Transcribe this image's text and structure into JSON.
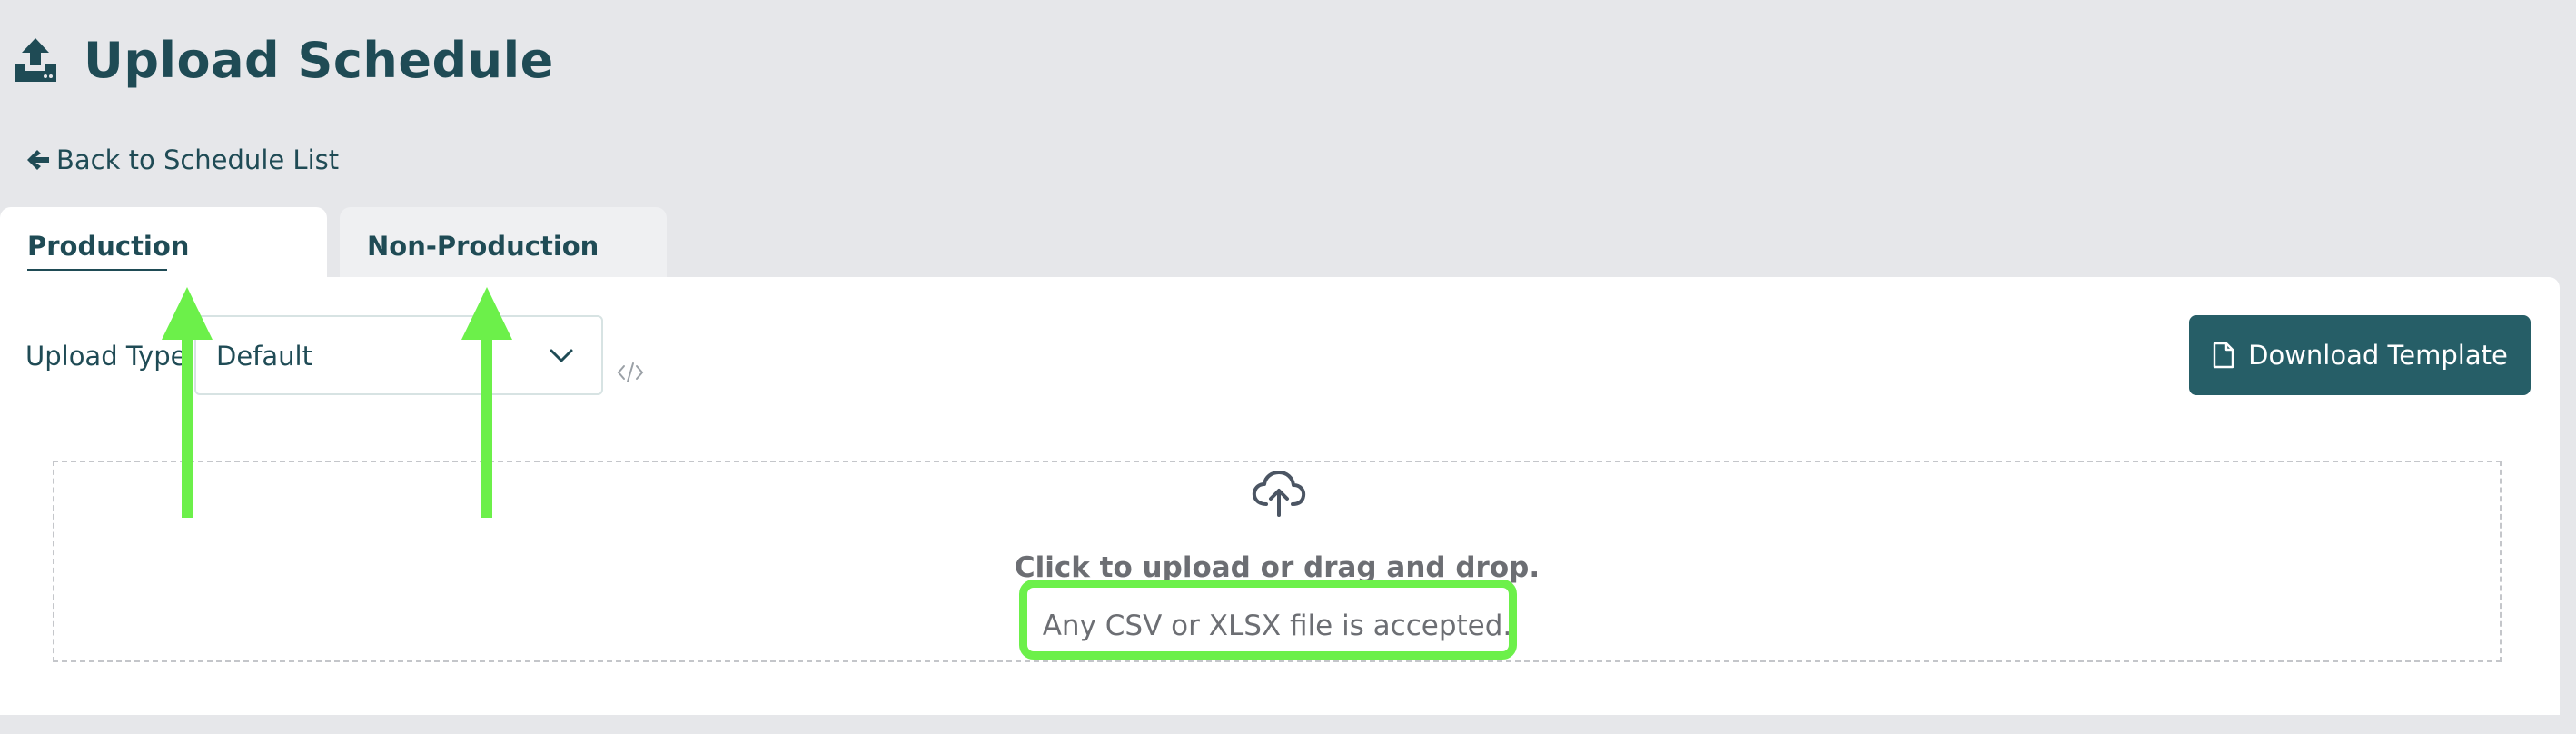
{
  "header": {
    "title": "Upload Schedule",
    "icon": "upload-icon"
  },
  "back_link": {
    "label": "Back to Schedule List",
    "icon": "arrow-left-icon"
  },
  "tabs": [
    {
      "label": "Production",
      "active": true
    },
    {
      "label": "Non-Production",
      "active": false
    }
  ],
  "upload_type": {
    "label": "Upload Type:",
    "selected": "Default"
  },
  "download_button": {
    "label": "Download Template",
    "icon": "file-icon"
  },
  "dropzone": {
    "primary": "Click to upload or drag and drop.",
    "secondary": "Any CSV or XLSX file is accepted.",
    "icon": "cloud-upload-icon"
  },
  "colors": {
    "brand": "#1f4b55",
    "button": "#265e67",
    "background": "#e6e7ea",
    "annotation": "#6cf04a"
  }
}
